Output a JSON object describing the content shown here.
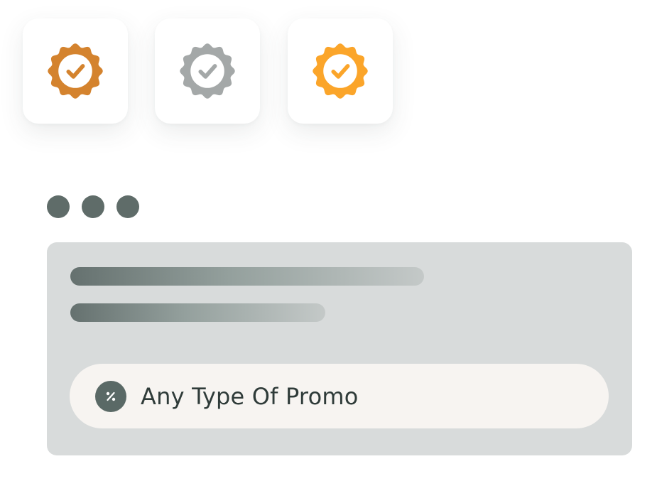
{
  "badges": [
    {
      "icon": "verified-badge-icon",
      "color": "#d4832e"
    },
    {
      "icon": "verified-badge-icon",
      "color": "#a4a8a8"
    },
    {
      "icon": "verified-badge-icon",
      "color": "#fba52a"
    }
  ],
  "window": {
    "dot_color": "#5f6c69",
    "panel_color": "#d8dbdb"
  },
  "promo": {
    "icon": "percent-icon",
    "label": "Any Type Of Promo"
  }
}
